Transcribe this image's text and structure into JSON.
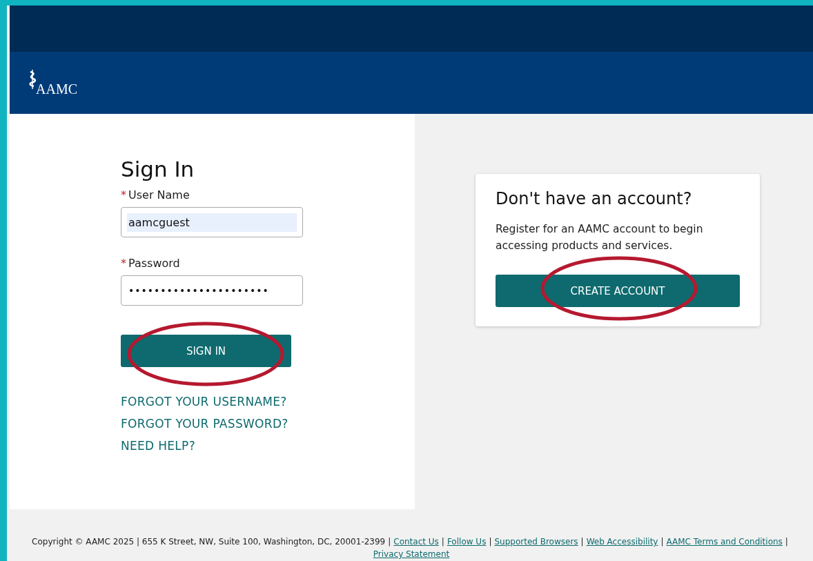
{
  "header": {
    "logo_text": "AAMC"
  },
  "sign_in": {
    "title": "Sign In",
    "fields": [
      {
        "label": "User Name",
        "required": true,
        "kind": "text",
        "value": "aamcguest",
        "autofilled": true
      },
      {
        "label": "Password",
        "required": true,
        "kind": "password",
        "value": "••••••••••••••••••••••",
        "autofilled": false
      }
    ],
    "button": {
      "label": "SIGN IN",
      "circled": true
    },
    "links": [
      "FORGOT YOUR USERNAME?",
      "FORGOT YOUR PASSWORD?",
      "NEED HELP?"
    ]
  },
  "register": {
    "title": "Don't have an account?",
    "text": "Register for an AAMC account to begin accessing products and services.",
    "button": {
      "label": "CREATE ACCOUNT",
      "circled": true
    }
  },
  "required_mark": "*",
  "footer": {
    "copyright": "Copyright © AAMC 2025 | 655 K Street, NW, Suite 100, Washington, DC, 20001-2399",
    "separator": "|",
    "links": [
      "Contact Us",
      "Follow Us",
      "Supported Browsers",
      "Web Accessibility",
      "AAMC Terms and Conditions",
      "Privacy Statement"
    ]
  }
}
